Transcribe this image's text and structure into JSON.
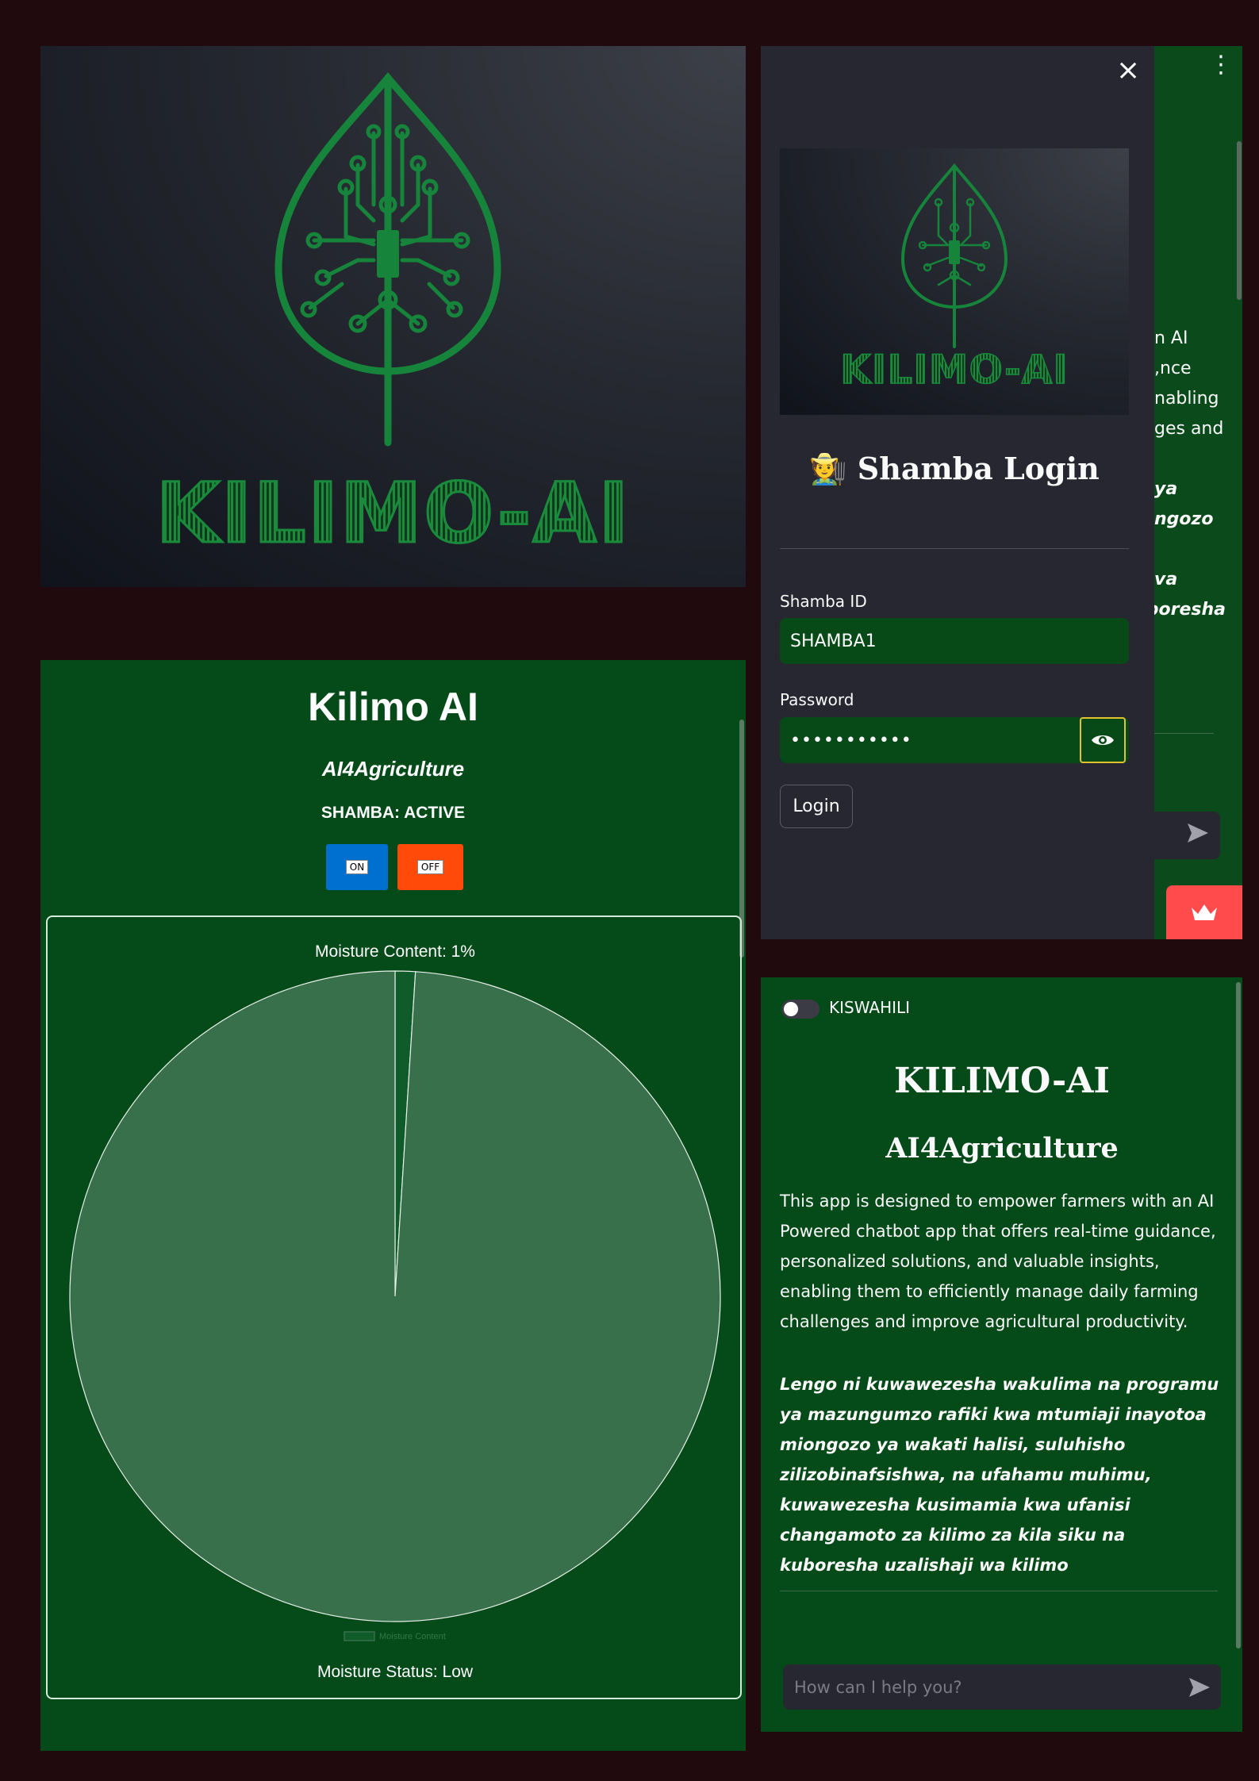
{
  "logo_panel": {
    "wordmark": "KILIMO-AI"
  },
  "login": {
    "logo_wordmark": "KILIMO-AI",
    "title_emoji": "🧑‍🌾",
    "title": "Shamba Login",
    "shamba_id_label": "Shamba ID",
    "shamba_id_value": "SHAMBA1",
    "password_label": "Password",
    "password_value": "•••••••••••",
    "login_button": "Login",
    "peek_lines": [
      "n AI",
      "nce,",
      "nabling",
      "ges and",
      "",
      "ya",
      "ngozo",
      "",
      "va",
      "boresha"
    ]
  },
  "dashboard": {
    "title": "Kilimo AI",
    "subtitle": "AI4Agriculture",
    "status": "SHAMBA: ACTIVE",
    "on_label": "ON",
    "off_label": "OFF",
    "moisture_status": "Moisture Status: Low"
  },
  "chart_data": {
    "type": "pie",
    "title": "Moisture Content: 1%",
    "categories": [
      "Moisture Content",
      ""
    ],
    "values": [
      1,
      99
    ],
    "legend": [
      "Moisture Content"
    ],
    "legend_position": "bottom",
    "colors": [
      "#0f5c2a",
      "#37704a"
    ]
  },
  "main": {
    "toggle_label": "KISWAHILI",
    "title": "KILIMO-AI",
    "subtitle": "AI4Agriculture",
    "description_en": "This app is designed to empower farmers with an AI Powered chatbot app that offers real-time guidance, personalized solutions, and valuable insights, enabling them to efficiently manage daily farming challenges and improve agricultural productivity.",
    "description_sw": "Lengo ni kuwawezesha wakulima na programu ya mazungumzo rafiki kwa mtumiaji inayotoa miongozo ya wakati halisi, suluhisho zilizobinafsishwa, na ufahamu muhimu, kuwawezesha kusimamia kwa ufanisi changamoto za kilimo za kila siku na kuboresha uzalishaji wa kilimo",
    "chat_placeholder": "How can I help you?"
  },
  "colors": {
    "background": "#200a0d",
    "app_green": "#054a19",
    "sidebar": "#262730",
    "accent_red": "#ff4b4b",
    "on_blue": "#0070d0",
    "off_orange": "#ff4a0a",
    "logo_green": "#1a8a3c"
  }
}
